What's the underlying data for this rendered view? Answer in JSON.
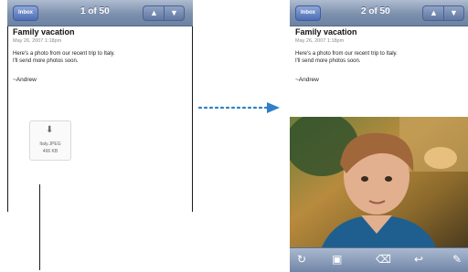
{
  "left_screen": {
    "nav": {
      "back_label": "Inbox",
      "counter": "1 of 50"
    },
    "email": {
      "subject": "Family vacation",
      "date": "May 26, 2007 1:18pm",
      "body_line1": "Here's a photo from our recent trip to Italy.",
      "body_line2": "I'll send more photos soon.",
      "signature": "~Andrew",
      "attachment": {
        "filename": "Italy.JPEG",
        "size": "466 KB"
      }
    }
  },
  "right_screen": {
    "nav": {
      "back_label": "Inbox",
      "counter": "2 of 50"
    },
    "email": {
      "subject": "Family vacation",
      "date": "May 26, 2007 1:18pm",
      "body_line1": "Here's a photo from our recent trip to Italy.",
      "body_line2": "I'll send more photos soon.",
      "signature": "~Andrew"
    },
    "toolbar_icons": [
      "refresh-icon",
      "move-folder-icon",
      "trash-icon",
      "reply-icon",
      "compose-icon"
    ]
  },
  "colors": {
    "navbar": "#7d90ad",
    "pointer": "#2f7fc9"
  }
}
